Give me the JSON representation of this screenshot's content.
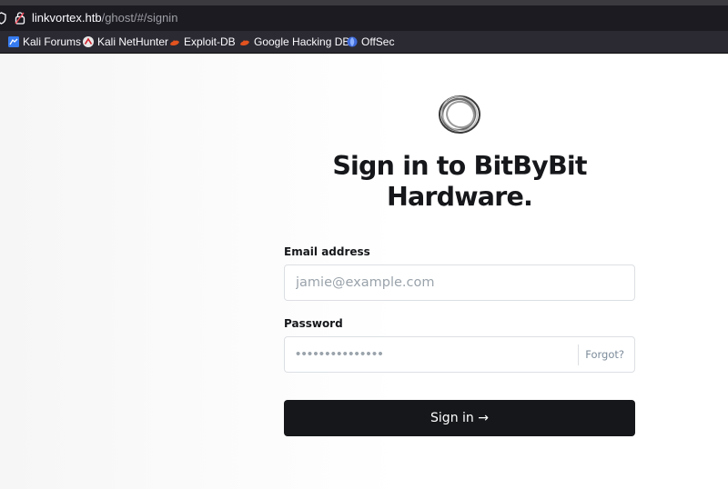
{
  "browser": {
    "url_host": "linkvortex.htb",
    "url_path": "/ghost/#/signin",
    "bookmarks": [
      {
        "label": "Kali Forums",
        "icon": "kali-forums-icon"
      },
      {
        "label": "Kali NetHunter",
        "icon": "kali-nethunter-icon"
      },
      {
        "label": "Exploit-DB",
        "icon": "exploit-db-icon"
      },
      {
        "label": "Google Hacking DB",
        "icon": "google-hacking-db-icon"
      },
      {
        "label": "OffSec",
        "icon": "offsec-icon"
      }
    ]
  },
  "signin": {
    "title": "Sign in to BitByBit Hardware.",
    "email_label": "Email address",
    "email_placeholder": "jamie@example.com",
    "password_label": "Password",
    "password_masked": "•••••••••••••••",
    "forgot_label": "Forgot?",
    "submit_label": "Sign in →"
  },
  "colors": {
    "accent": "#15171a",
    "field_border": "#dcdfe3",
    "chrome_dark": "#1c1b22"
  }
}
